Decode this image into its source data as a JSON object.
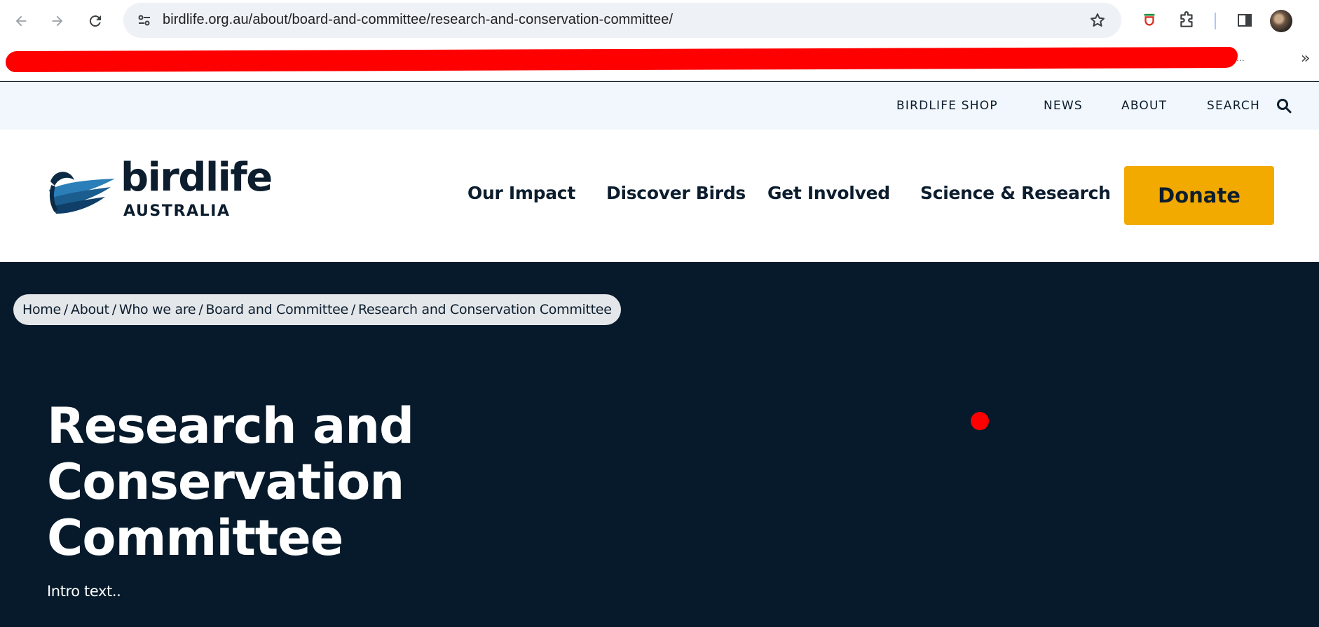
{
  "browser": {
    "url": "birdlife.org.au/about/board-and-committee/research-and-conservation-committee/",
    "bookmarks_overflow": "..."
  },
  "utility_nav": {
    "items": [
      "BIRDLIFE SHOP",
      "NEWS",
      "ABOUT",
      "SEARCH"
    ]
  },
  "logo": {
    "word": "birdlife",
    "sub": "AUSTRALIA"
  },
  "main_nav": {
    "items": [
      "Our Impact",
      "Discover Birds",
      "Get Involved",
      "Science & Research"
    ],
    "donate_label": "Donate"
  },
  "breadcrumb": {
    "items": [
      "Home",
      "About",
      "Who we are",
      "Board and Committee",
      "Research and Conservation Committee"
    ],
    "separator": "/"
  },
  "hero": {
    "title_lines": [
      "Research and",
      "Conservation",
      "Committee"
    ],
    "intro": "Intro text.."
  },
  "colors": {
    "hero_bg": "#061a2b",
    "donate_bg": "#f2a900",
    "utility_bg": "#f1f7fc",
    "brand_blue": "#2a7fb8",
    "annotation_red": "#ff0000"
  }
}
